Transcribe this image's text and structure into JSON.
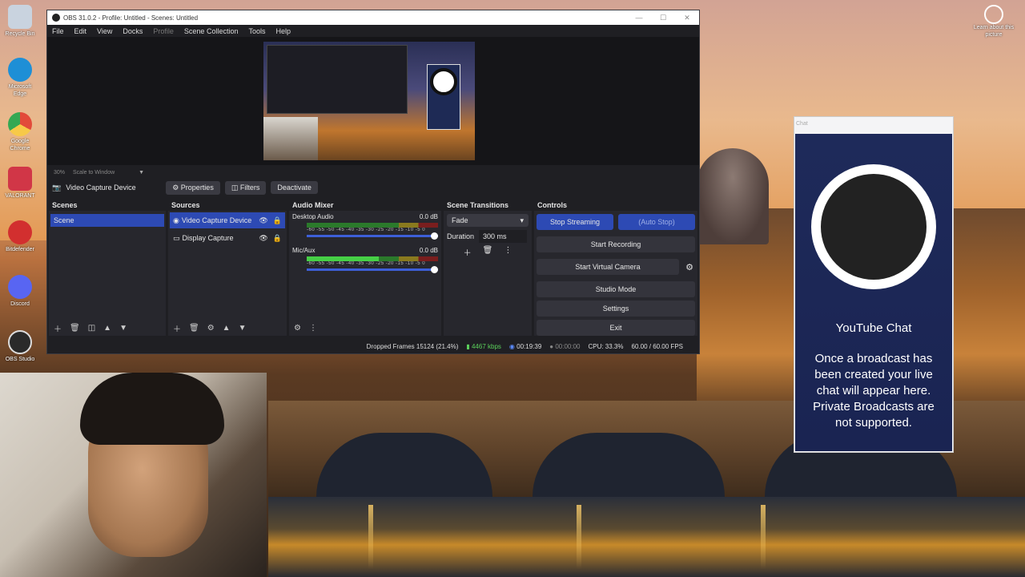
{
  "window": {
    "title": "OBS 31.0.2 - Profile: Untitled - Scenes: Untitled",
    "minimize": "—",
    "maximize": "☐",
    "close": "✕"
  },
  "menu": [
    "File",
    "Edit",
    "View",
    "Docks",
    "Profile",
    "Scene Collection",
    "Tools",
    "Help"
  ],
  "preview": {
    "zoom": "30%",
    "scale_mode": "Scale to Window"
  },
  "source_toolbar": {
    "source_name": "Video Capture Device",
    "properties": "Properties",
    "filters": "Filters",
    "deactivate": "Deactivate"
  },
  "scenes": {
    "header": "Scenes",
    "items": [
      "Scene"
    ]
  },
  "sources": {
    "header": "Sources",
    "items": [
      {
        "name": "Video Capture Device",
        "selected": true
      },
      {
        "name": "Display Capture",
        "selected": false
      }
    ]
  },
  "audio_mixer": {
    "header": "Audio Mixer",
    "channels": [
      {
        "name": "Desktop Audio",
        "db": "0.0 dB",
        "level": 0.0
      },
      {
        "name": "Mic/Aux",
        "db": "0.0 dB",
        "level": 0.55
      }
    ],
    "ticks": "-60 -55 -50 -45 -40 -35 -30 -25 -20 -15 -10 -5 0"
  },
  "scene_transitions": {
    "header": "Scene Transitions",
    "transition": "Fade",
    "duration_label": "Duration",
    "duration_value": "300 ms"
  },
  "controls": {
    "header": "Controls",
    "stop_streaming": "Stop Streaming",
    "auto_stop": "(Auto Stop)",
    "start_recording": "Start Recording",
    "start_virtual_camera": "Start Virtual Camera",
    "studio_mode": "Studio Mode",
    "settings": "Settings",
    "exit": "Exit"
  },
  "status": {
    "dropped_frames": "Dropped Frames 15124 (21.4%)",
    "bitrate": "4467 kbps",
    "stream_time": "00:19:39",
    "record_time": "00:00:00",
    "cpu": "CPU: 33.3%",
    "fps": "60.00 / 60.00 FPS"
  },
  "desktop_icons": [
    {
      "label": "Recycle Bin",
      "color": "#c9d3df"
    },
    {
      "label": "Microsoft Edge",
      "color": "#1e8fd6"
    },
    {
      "label": "Google Chrome",
      "color": "#e24a3a"
    },
    {
      "label": "VALORANT",
      "color": "#d13647"
    },
    {
      "label": "Bitdefender",
      "color": "#d22f2f"
    },
    {
      "label": "Discord",
      "color": "#5865f2"
    },
    {
      "label": "OBS Studio",
      "color": "#2a2a2a"
    }
  ],
  "top_right_icon": {
    "label": "Learn about this picture"
  },
  "chat_dock": {
    "header": "Chat",
    "title": "YouTube Chat",
    "message": "Once a broadcast has been created your live chat will appear here. Private Broadcasts are not supported."
  }
}
